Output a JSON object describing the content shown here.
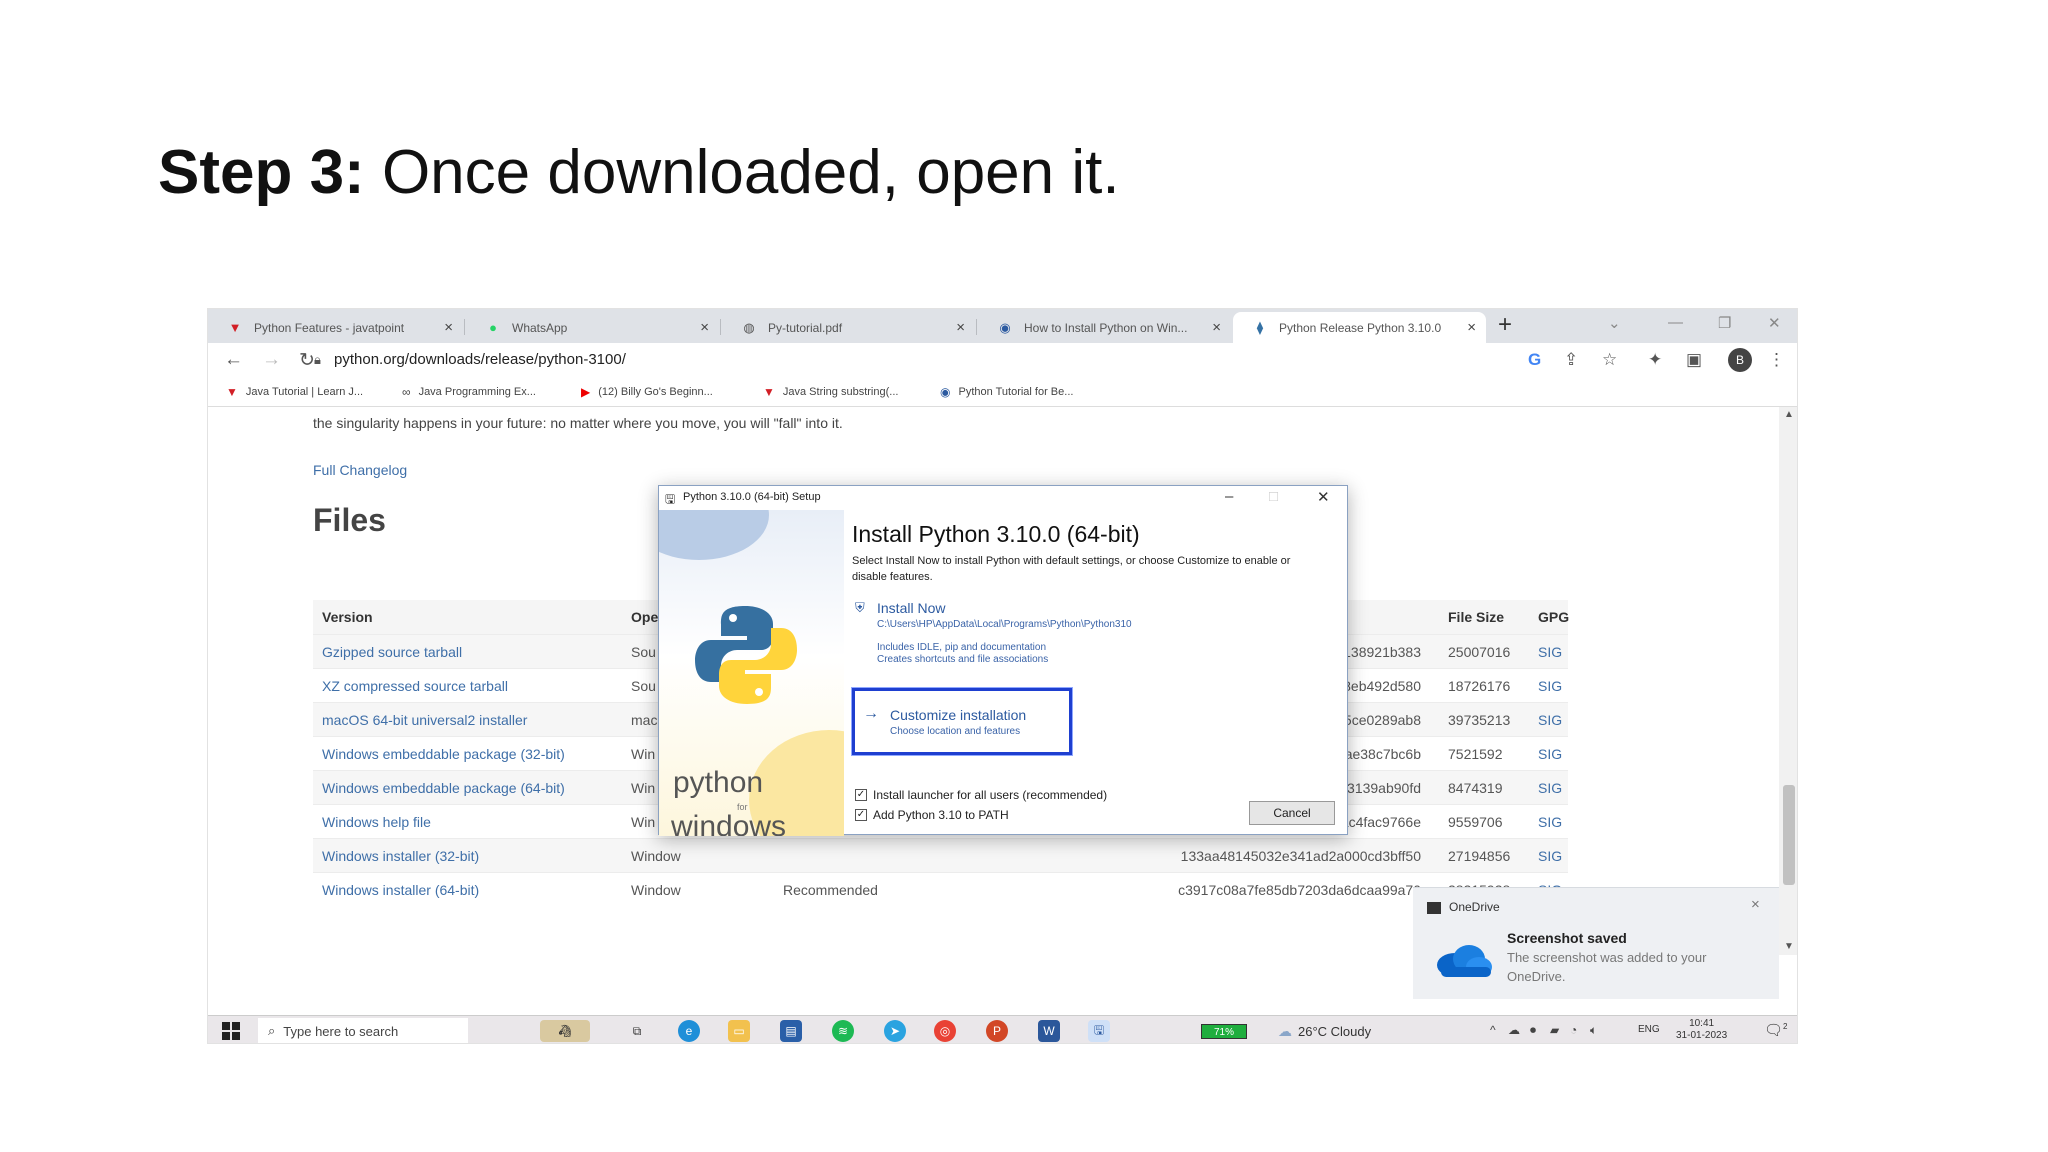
{
  "slide": {
    "title_strong": "Step 3:",
    "title_rest": " Once downloaded, open it."
  },
  "browser": {
    "tabs": [
      {
        "label": "Python Features - javatpoint",
        "icon": "javatpoint-icon",
        "active": false
      },
      {
        "label": "WhatsApp",
        "icon": "whatsapp-icon",
        "active": false
      },
      {
        "label": "Py-tutorial.pdf",
        "icon": "globe-icon",
        "active": false
      },
      {
        "label": "How to Install Python on Win...",
        "icon": "info-icon",
        "active": false
      },
      {
        "label": "Python Release Python 3.10.0",
        "icon": "python-icon",
        "active": true
      }
    ],
    "url": "python.org/downloads/release/python-3100/",
    "avatar_letter": "B",
    "bookmarks": [
      {
        "label": "Java Tutorial | Learn J...",
        "icon": "javatpoint-icon"
      },
      {
        "label": "Java Programming Ex...",
        "icon": "glasses-icon"
      },
      {
        "label": "(12) Billy Go's Beginn...",
        "icon": "youtube-icon"
      },
      {
        "label": "Java String substring(...",
        "icon": "javatpoint-icon"
      },
      {
        "label": "Python Tutorial for Be...",
        "icon": "info-icon"
      }
    ]
  },
  "page": {
    "singularity_text": "the singularity happens in your future: no matter where you move, you will \"fall\" into it.",
    "changelog_link": "Full Changelog",
    "files_heading": "Files",
    "table": {
      "headers": {
        "version": "Version",
        "os": "Ope",
        "size": "File Size",
        "gpg": "GPG"
      },
      "rows": [
        {
          "version": "Gzipped source tarball",
          "os": "Sou",
          "desc": "",
          "md5": "a832b01cf9138921b383",
          "size": "25007016",
          "gpg": "SIG"
        },
        {
          "version": "XZ compressed source tarball",
          "os": "Sou",
          "desc": "",
          "md5": "9f80e3ce4e8eb492d580",
          "size": "18726176",
          "gpg": "SIG"
        },
        {
          "version": "macOS 64-bit universal2 installer",
          "os": "mac",
          "desc": "",
          "md5": "a2f0414e25ce0289ab8",
          "size": "39735213",
          "gpg": "SIG"
        },
        {
          "version": "Windows embeddable package (32-bit)",
          "os": "Win",
          "desc": "",
          "md5": "d78f5e48edae38c7bc6b",
          "size": "7521592",
          "gpg": "SIG"
        },
        {
          "version": "Windows embeddable package (64-bit)",
          "os": "Win",
          "desc": "",
          "md5": "59d5eaf93139ab90fd",
          "size": "8474319",
          "gpg": "SIG"
        },
        {
          "version": "Windows help file",
          "os": "Win",
          "desc": "",
          "md5": "b2cecd63ac4fac9766e",
          "size": "9559706",
          "gpg": "SIG"
        },
        {
          "version": "Windows installer (32-bit)",
          "os": "Windows",
          "desc": "",
          "md5": "133aa48145032e341ad2a000cd3bff50",
          "size": "27194856",
          "gpg": "SIG"
        },
        {
          "version": "Windows installer (64-bit)",
          "os": "Windows",
          "desc": "Recommended",
          "md5": "c3917c08a7fe85db7203da6dcaa99a70",
          "size": "28315928",
          "gpg": "SIG"
        }
      ]
    }
  },
  "dialog": {
    "window_title": "Python 3.10.0 (64-bit) Setup",
    "heading": "Install Python 3.10.0 (64-bit)",
    "subtitle": "Select Install Now to install Python with default settings, or choose Customize to enable or disable features.",
    "install_now": {
      "label": "Install Now",
      "path": "C:\\Users\\HP\\AppData\\Local\\Programs\\Python\\Python310",
      "includes": "Includes IDLE, pip and documentation",
      "creates": "Creates shortcuts and file associations"
    },
    "customize": {
      "label": "Customize installation",
      "sub": "Choose location and features"
    },
    "checkbox_launcher": "Install launcher for all users (recommended)",
    "checkbox_path": "Add Python 3.10 to PATH",
    "cancel": "Cancel",
    "brand_python": "python",
    "brand_for": "for",
    "brand_windows": "windows"
  },
  "toast": {
    "app": "OneDrive",
    "heading": "Screenshot saved",
    "body": "The screenshot was added to your OneDrive."
  },
  "taskbar": {
    "search_placeholder": "Type here to search",
    "battery": "71%",
    "weather": "26°C  Cloudy",
    "lang": "ENG",
    "time": "10:41",
    "date": "31-01-2023",
    "notif_count": "2"
  },
  "colors": {
    "accent_link": "#3f6fa8",
    "focus_border": "#1e3fd0",
    "battery_green": "#1fae3e"
  }
}
